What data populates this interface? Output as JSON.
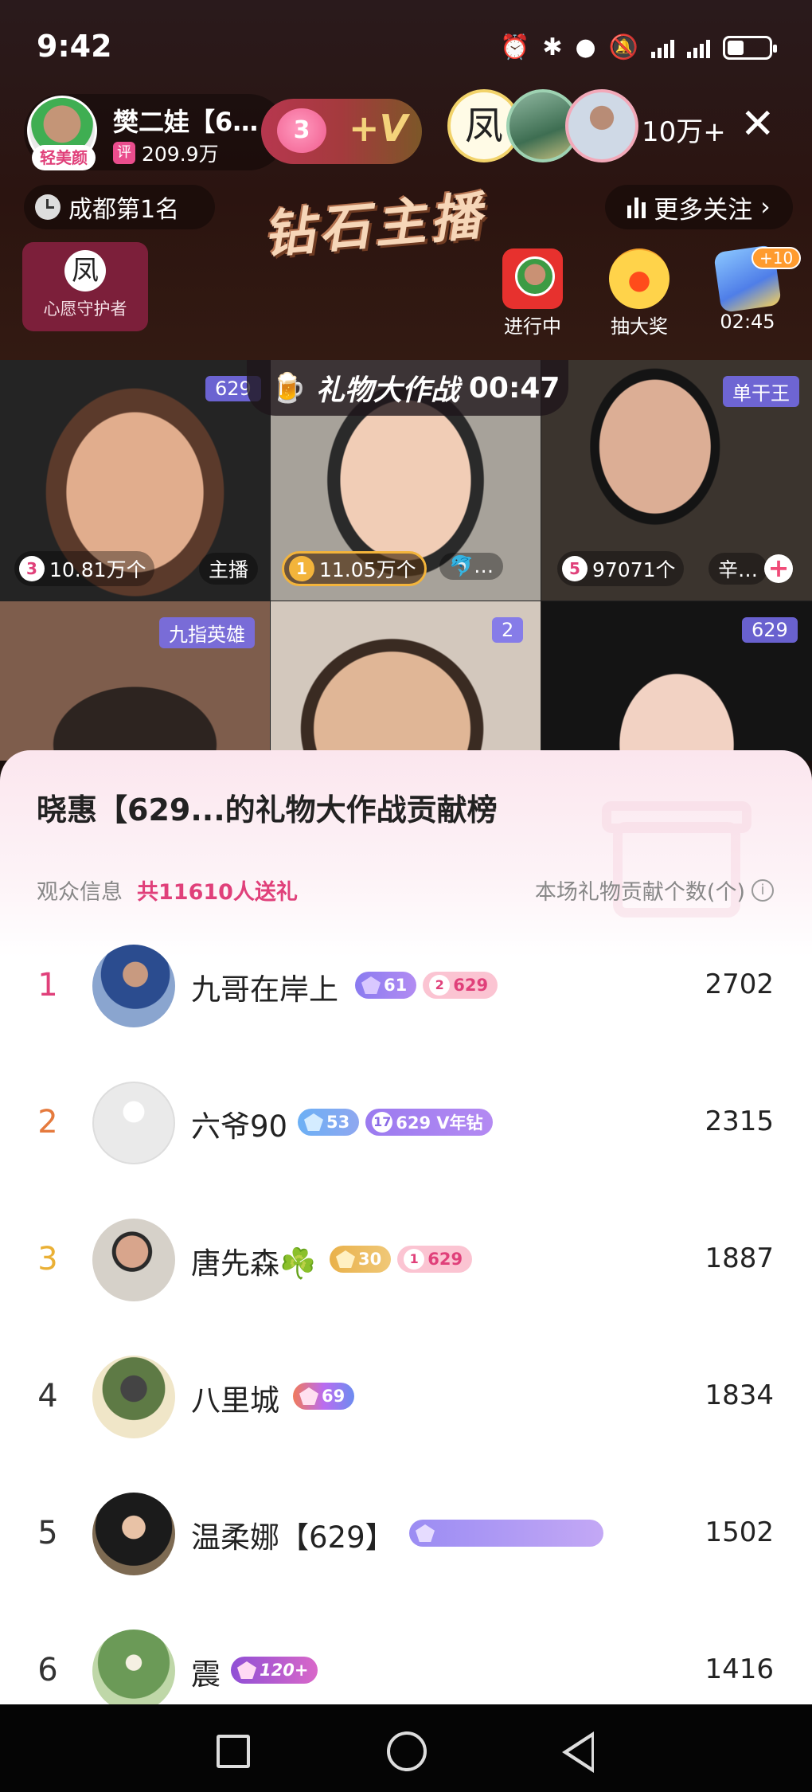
{
  "status_bar": {
    "time": "9:42"
  },
  "host": {
    "name": "樊二娃【6…",
    "beauty_badge": "轻美颜",
    "fans_icon_label": "评",
    "fans_count": "209.9万",
    "fan_level": "3",
    "fan_plus": "+V"
  },
  "viewers": {
    "count": "10万+",
    "top_viewer_glyph": "凤"
  },
  "close_label": "✕",
  "city_rank": "成都第1名",
  "title_banner": "钻石主播",
  "more_follow": "更多关注",
  "wish_guardian": {
    "glyph": "凤",
    "label": "心愿守护者"
  },
  "activities": [
    {
      "label": "进行中"
    },
    {
      "label": "抽大奖"
    },
    {
      "label": "02:45",
      "badge": "+10"
    }
  ],
  "gift_war": {
    "title": "礼物大作战",
    "time": "00:47"
  },
  "tiles": [
    {
      "tag": "629",
      "rank": "3",
      "count": "10.81万个",
      "role": "主播"
    },
    {
      "rank": "1",
      "count": "11.05万个",
      "role": "🐬…"
    },
    {
      "tag": "单干王",
      "rank": "5",
      "count": "97071个",
      "role": "辛…"
    },
    {
      "tag": "九指英雄"
    },
    {
      "tag": "2"
    },
    {
      "tag": "629"
    }
  ],
  "sheet": {
    "title": "晓惠【629...的礼物大作战贡献榜",
    "audience_label": "观众信息",
    "audience_count": "共11610人送礼",
    "contribution_label": "本场礼物贡献个数(个)",
    "info_icon": "i"
  },
  "ranking": [
    {
      "rank": "1",
      "name": "九哥在岸上",
      "score": "2702",
      "badges": [
        {
          "text": "61"
        },
        {
          "num": "2",
          "text": "629"
        }
      ]
    },
    {
      "rank": "2",
      "name": "六爷90",
      "score": "2315",
      "badges": [
        {
          "text": "53"
        },
        {
          "num": "17",
          "text": "629 V年钻"
        }
      ]
    },
    {
      "rank": "3",
      "name": "唐先森☘️",
      "score": "1887",
      "badges": [
        {
          "text": "30"
        },
        {
          "num": "1",
          "text": "629"
        }
      ]
    },
    {
      "rank": "4",
      "name": "八里城",
      "score": "1834",
      "badges": [
        {
          "text": "69"
        }
      ]
    },
    {
      "rank": "5",
      "name": "温柔娜【629】",
      "score": "1502",
      "badges": []
    },
    {
      "rank": "6",
      "name": "震",
      "score": "1416",
      "badges": [
        {
          "text": "120+"
        }
      ]
    }
  ]
}
